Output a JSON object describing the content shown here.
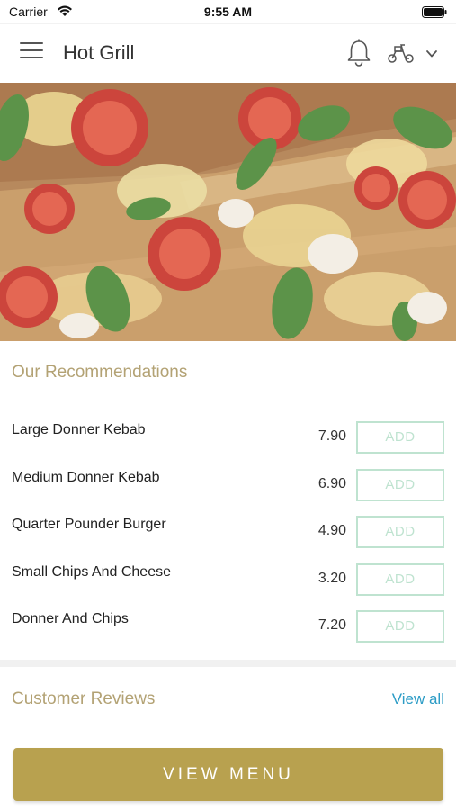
{
  "status_bar": {
    "carrier": "Carrier",
    "time": "9:55 AM"
  },
  "header": {
    "title": "Hot Grill",
    "icons": [
      "menu-icon",
      "bell-icon",
      "scooter-icon",
      "chevron-down-icon"
    ]
  },
  "hero": {
    "image": "pizza-image"
  },
  "recommendations": {
    "title": "Our Recommendations",
    "add_label": "ADD",
    "items": [
      {
        "name": "Large Donner Kebab",
        "price": "7.90"
      },
      {
        "name": "Medium Donner Kebab",
        "price": "6.90"
      },
      {
        "name": "Quarter Pounder Burger",
        "price": "4.90"
      },
      {
        "name": "Small Chips And Cheese",
        "price": "3.20"
      },
      {
        "name": "Donner And Chips",
        "price": "7.20"
      }
    ]
  },
  "reviews": {
    "title": "Customer Reviews",
    "view_all": "View all"
  },
  "footer": {
    "view_menu": "VIEW MENU"
  },
  "colors": {
    "accent_gold": "#b8a14f",
    "section_title": "#b3a274",
    "add_button": "#bfe3d0",
    "link": "#2c9cc6"
  }
}
